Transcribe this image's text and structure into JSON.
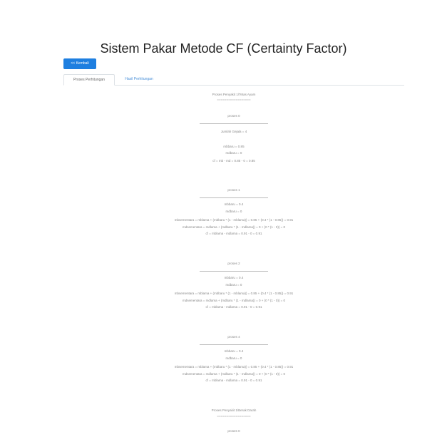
{
  "header": {
    "title": "Sistem Pakar Metode CF (Certainty Factor)"
  },
  "toolbar": {
    "back_label": "<< Kembali"
  },
  "tabs": [
    {
      "label": "Proses Perhitungan"
    },
    {
      "label": "Hasil Perhitungan"
    }
  ],
  "process": {
    "heading_1": "Proses Penyakit 1/Tetas Ayam",
    "underline_1": "==================",
    "steps": [
      {
        "title": "proses 0",
        "lines": [
          "Jumlah Gejala = 4",
          "",
          "mbbaru = 0.85",
          "mdbaru = 0",
          "cf = mb - md = 0.85 - 0 = 0.85"
        ]
      },
      {
        "title": "proses 1",
        "lines": [
          "mbbaru = 0.4",
          "mdbaru = 0",
          "mbsementara = mblama + (mbbaru * (1 - mblama)) = 0.85 + (0.4 * (1 - 0.85)) = 0.91",
          "mdsementara = mdlama + (mdbaru * (1 - mdlama)) = 0 + (0 * (1 - 0)) = 0",
          "cf = mblama - mdlama = 0.91 - 0 = 0.91"
        ]
      },
      {
        "title": "proses 2",
        "lines": [
          "mbbaru = 0.4",
          "mdbaru = 0",
          "mbsementara = mblama + (mbbaru * (1 - mblama)) = 0.85 + (0.4 * (1 - 0.85)) = 0.91",
          "mdsementara = mdlama + (mdbaru * (1 - mdlama)) = 0 + (0 * (1 - 0)) = 0",
          "cf = mblama - mdlama = 0.91 - 0 = 0.91"
        ]
      },
      {
        "title": "proses 4",
        "lines": [
          "mbbaru = 0.4",
          "mdbaru = 0",
          "mbsementara = mblama + (mbbaru * (1 - mblama)) = 0.85 + (0.4 * (1 - 0.85)) = 0.91",
          "mdsementara = mdlama + (mdbaru * (1 - mdlama)) = 0 + (0 * (1 - 0)) = 0",
          "cf = mblama - mdlama = 0.91 - 0 = 0.91"
        ]
      }
    ],
    "heading_2": "Proses Penyakit 1/Berak Darah",
    "underline_2": "==================",
    "last_step_title": "proses 0"
  }
}
